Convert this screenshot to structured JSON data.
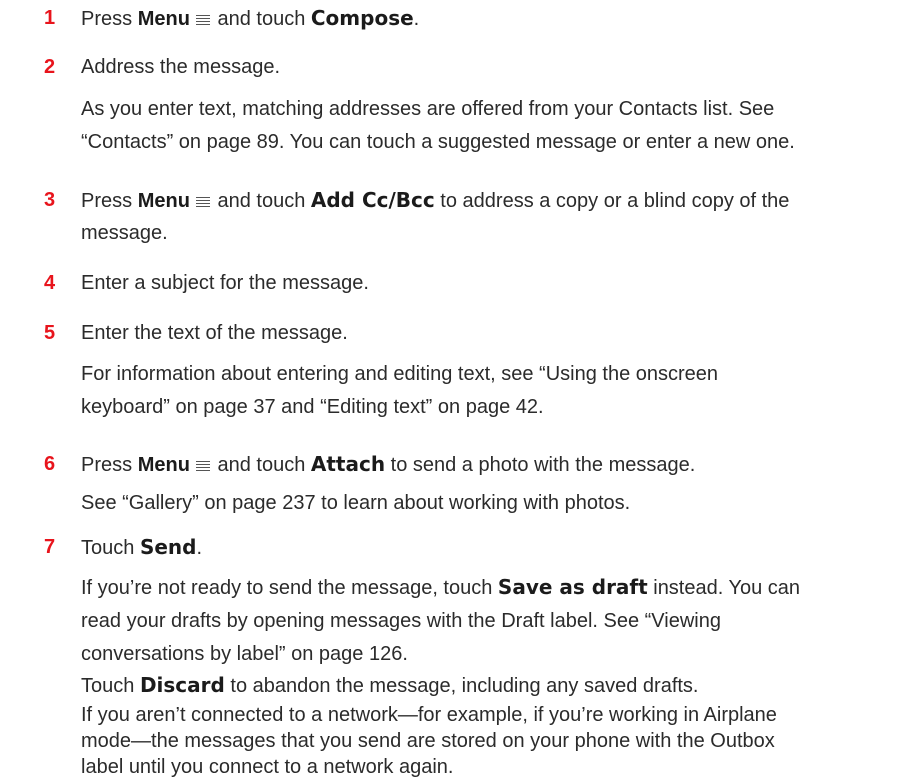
{
  "colors": {
    "step_number": "#e8141c",
    "text": "#2b2b2b"
  },
  "steps": [
    {
      "number": "1",
      "parts": [
        "Press ",
        "Menu",
        " and touch ",
        "Compose",
        "."
      ]
    },
    {
      "number": "2",
      "text": "Address the message."
    },
    {
      "number": "3",
      "parts": [
        "Press ",
        "Menu",
        " and touch ",
        "Add Cc/Bcc",
        " to address a copy or a blind copy of the",
        "message."
      ]
    },
    {
      "number": "4",
      "text": "Enter a subject for the message."
    },
    {
      "number": "5",
      "text": "Enter the text of the message."
    },
    {
      "number": "6",
      "parts": [
        "Press ",
        "Menu",
        " and touch ",
        "Attach",
        " to send a photo with the message."
      ]
    },
    {
      "number": "7",
      "parts": [
        "Touch ",
        "Send",
        "."
      ]
    }
  ],
  "notes": {
    "step2": [
      "As you enter text, matching addresses are offered from your Contacts list. See",
      "“Contacts” on page 89. You can touch a suggested message or enter a new one."
    ],
    "step5": [
      "For information about entering and editing text, see “Using the onscreen",
      "keyboard” on page 37 and “Editing text” on page 42."
    ],
    "step6": "See “Gallery” on page 237 to learn about working with photos.",
    "step7a": [
      "If you’re not ready to send the message, touch ",
      "Save as draft",
      " instead. You can",
      "read your drafts by opening messages with the Draft label. See “Viewing",
      "conversations by label” on page 126."
    ],
    "step7b": [
      "Touch ",
      "Discard",
      " to abandon the message, including any saved drafts."
    ],
    "step7c": [
      "If you aren’t connected to a network—for example, if you’re working in Airplane",
      "mode—the messages that you send are stored on your phone with the Outbox",
      "label until you connect to a network again."
    ]
  },
  "icons": {
    "menu": "menu-icon"
  }
}
